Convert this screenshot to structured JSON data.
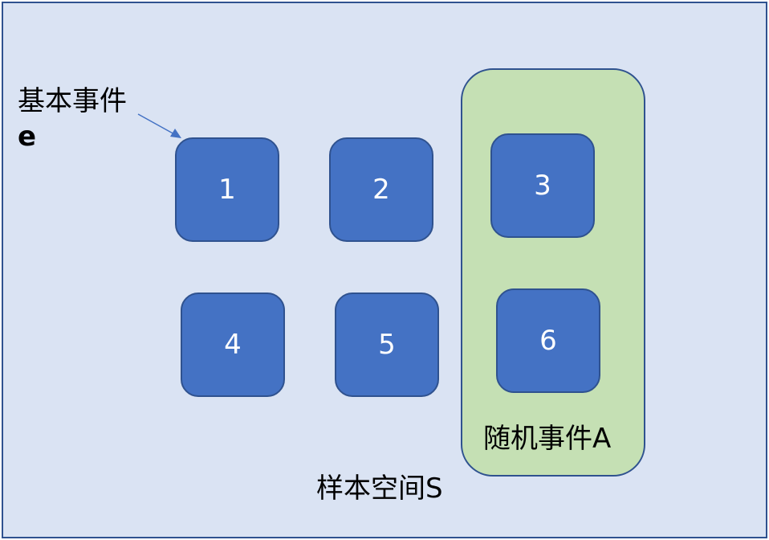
{
  "colors": {
    "sample_space_fill": "#dae3f3",
    "outline": "#2f528f",
    "outcome_fill": "#4472c4",
    "event_fill": "#c5e0b4",
    "arrow": "#4472c4"
  },
  "elementary_event": {
    "label": "基本事件",
    "symbol": "e"
  },
  "outcomes": [
    "1",
    "2",
    "3",
    "4",
    "5",
    "6"
  ],
  "random_event": {
    "label": "随机事件A",
    "members": [
      "3",
      "6"
    ]
  },
  "sample_space": {
    "label": "样本空间S"
  },
  "icons": {
    "pointer": "arrow-icon"
  }
}
